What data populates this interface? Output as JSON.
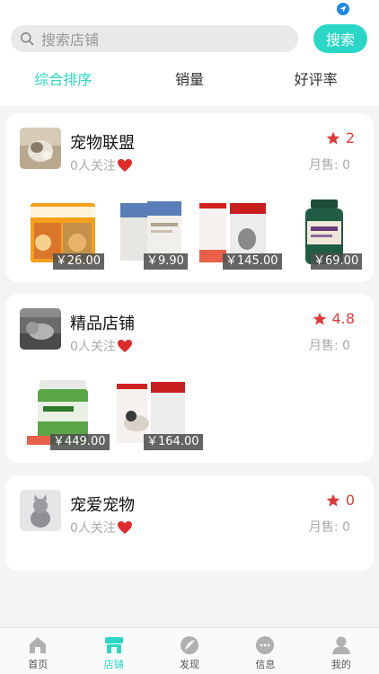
{
  "search": {
    "placeholder": "搜索店铺",
    "button_label": "搜索"
  },
  "sort_tabs": [
    {
      "label": "综合排序",
      "active": true
    },
    {
      "label": "销量",
      "active": false
    },
    {
      "label": "好评率",
      "active": false
    }
  ],
  "shops": [
    {
      "name": "宠物联盟",
      "followers": "0人关注",
      "rating": "2",
      "monthly_sales": "月售: 0",
      "products": [
        {
          "price": "￥26.00",
          "icon": "cat-food-pouch-image"
        },
        {
          "price": "￥9.90",
          "icon": "mag-lecithin-box-image"
        },
        {
          "price": "￥145.00",
          "icon": "royal-canin-cat-food-image"
        },
        {
          "price": "￥69.00",
          "icon": "hairball-relief-bottle-image"
        }
      ]
    },
    {
      "name": "精品店铺",
      "followers": "0人关注",
      "rating": "4.8",
      "monthly_sales": "月售: 0",
      "products": [
        {
          "price": "￥449.00",
          "icon": "soshoi-supplement-tub-image"
        },
        {
          "price": "￥164.00",
          "icon": "royal-canin-dog-food-image"
        }
      ]
    },
    {
      "name": "宠爱宠物",
      "followers": "0人关注",
      "rating": "0",
      "monthly_sales": "月售: 0",
      "products": []
    }
  ],
  "tabbar": [
    {
      "label": "首页",
      "icon": "home-icon",
      "active": false
    },
    {
      "label": "店铺",
      "icon": "shop-icon",
      "active": true
    },
    {
      "label": "发现",
      "icon": "discover-icon",
      "active": false
    },
    {
      "label": "信息",
      "icon": "message-icon",
      "active": false
    },
    {
      "label": "我的",
      "icon": "profile-icon",
      "active": false
    }
  ],
  "colors": {
    "accent": "#2ad7c6",
    "rating_red": "#e03a3a",
    "location_blue": "#1e88e5"
  }
}
